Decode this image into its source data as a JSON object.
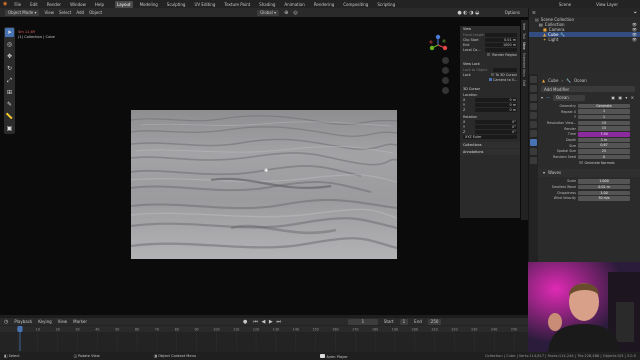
{
  "menu": {
    "items": [
      "File",
      "Edit",
      "Render",
      "Window",
      "Help"
    ],
    "workspaces": [
      "Layout",
      "Modeling",
      "Sculpting",
      "UV Editing",
      "Texture Paint",
      "Shading",
      "Animation",
      "Rendering",
      "Compositing",
      "Scripting"
    ],
    "active_workspace": "Layout",
    "scene": "Scene",
    "view_layer": "View Layer"
  },
  "viewport_header": {
    "mode": "Object Mode",
    "view": "View",
    "select": "Select",
    "add": "Add",
    "object": "Object",
    "orientation": "Global",
    "options": "Options"
  },
  "viewport_info": {
    "line1": "Sm 11.69",
    "line2": "(1) Collection | Cube"
  },
  "npanel": {
    "view_title": "View",
    "focal_label": "Focal Length",
    "clip_start_label": "Clip Start",
    "clip_start": "0.01 m",
    "end_label": "End",
    "end": "1000 m",
    "local_camera_label": "Local Ca...",
    "render_region": "Render Region",
    "view_lock_title": "View Lock",
    "lock_to_object": "Lock to Object",
    "lock_label": "Lock",
    "to_3d_cursor": "To 3D Cursor",
    "camera_to_view": "Camera to V...",
    "cursor_title": "3D Cursor",
    "location_label": "Location",
    "x_label": "X",
    "x_val": "0 m",
    "y_label": "Y",
    "y_val": "0 m",
    "z_label": "Z",
    "z_val": "0 m",
    "rotation_label": "Rotation",
    "rx": "0°",
    "ry": "0°",
    "rz": "0°",
    "rot_mode": "XYZ Euler",
    "collections": "Collections",
    "annotations": "Annotations",
    "tabs": [
      "Item",
      "Tool",
      "View",
      "Extended Keys",
      "Edit"
    ]
  },
  "timeline": {
    "playback": "Playback",
    "keying": "Keying",
    "view": "View",
    "marker": "Marker",
    "current_frame": "1",
    "start_label": "Start",
    "start": "1",
    "end_label": "End",
    "end": "250",
    "ticks": [
      "0",
      "10",
      "20",
      "30",
      "40",
      "50",
      "60",
      "70",
      "80",
      "90",
      "100",
      "110",
      "120",
      "130",
      "140",
      "150",
      "160",
      "170",
      "180",
      "190",
      "200",
      "210",
      "220",
      "230",
      "240",
      "250"
    ]
  },
  "status": {
    "select": "Select",
    "rotate": "Rotate View",
    "context": "Object Context Menu",
    "anim_player": "Anim Player",
    "stats": "Collection | Cube | Verts:114,817 | Faces:114,244 | Tris:228,488 | Objects:0/3 | 3.0.0"
  },
  "outliner": {
    "title": "Scene Collection",
    "items": [
      {
        "label": "Collection",
        "indent": 1
      },
      {
        "label": "Camera",
        "indent": 2
      },
      {
        "label": "Cube",
        "indent": 2
      },
      {
        "label": "Light",
        "indent": 2
      }
    ],
    "selected": "Cube"
  },
  "properties": {
    "object": "Cube",
    "modifier_type": "Ocean",
    "add_modifier": "Add Modifier",
    "modifier_name": "Ocean",
    "rows": [
      {
        "label": "Geometry",
        "value": "Generate"
      },
      {
        "label": "Repeat X",
        "value": "1"
      },
      {
        "label": "Y",
        "value": "1"
      },
      {
        "label": "Resolution View...",
        "value": "15"
      },
      {
        "label": "Render",
        "value": "15"
      },
      {
        "label": "Time",
        "value": "7.50"
      },
      {
        "label": "Depth",
        "value": "1 m"
      },
      {
        "label": "Size",
        "value": "0.67"
      },
      {
        "label": "Spatial Size",
        "value": "25"
      },
      {
        "label": "Random Seed",
        "value": "0"
      }
    ],
    "generate_normals": "Generate Normals",
    "waves_title": "Waves",
    "wave_rows": [
      {
        "label": "Scale",
        "value": "1.000"
      },
      {
        "label": "Smallest Wave",
        "value": "0.01 m"
      },
      {
        "label": "Choppiness",
        "value": "1.00"
      },
      {
        "label": "Wind Velocity",
        "value": "30 m/s"
      }
    ],
    "highlight_color": "#8c2ba0"
  },
  "colors": {
    "accent": "#4772b3",
    "selected_row": "#334d80",
    "time_field": "#8c2ba0",
    "playhead": "#4772b3"
  }
}
